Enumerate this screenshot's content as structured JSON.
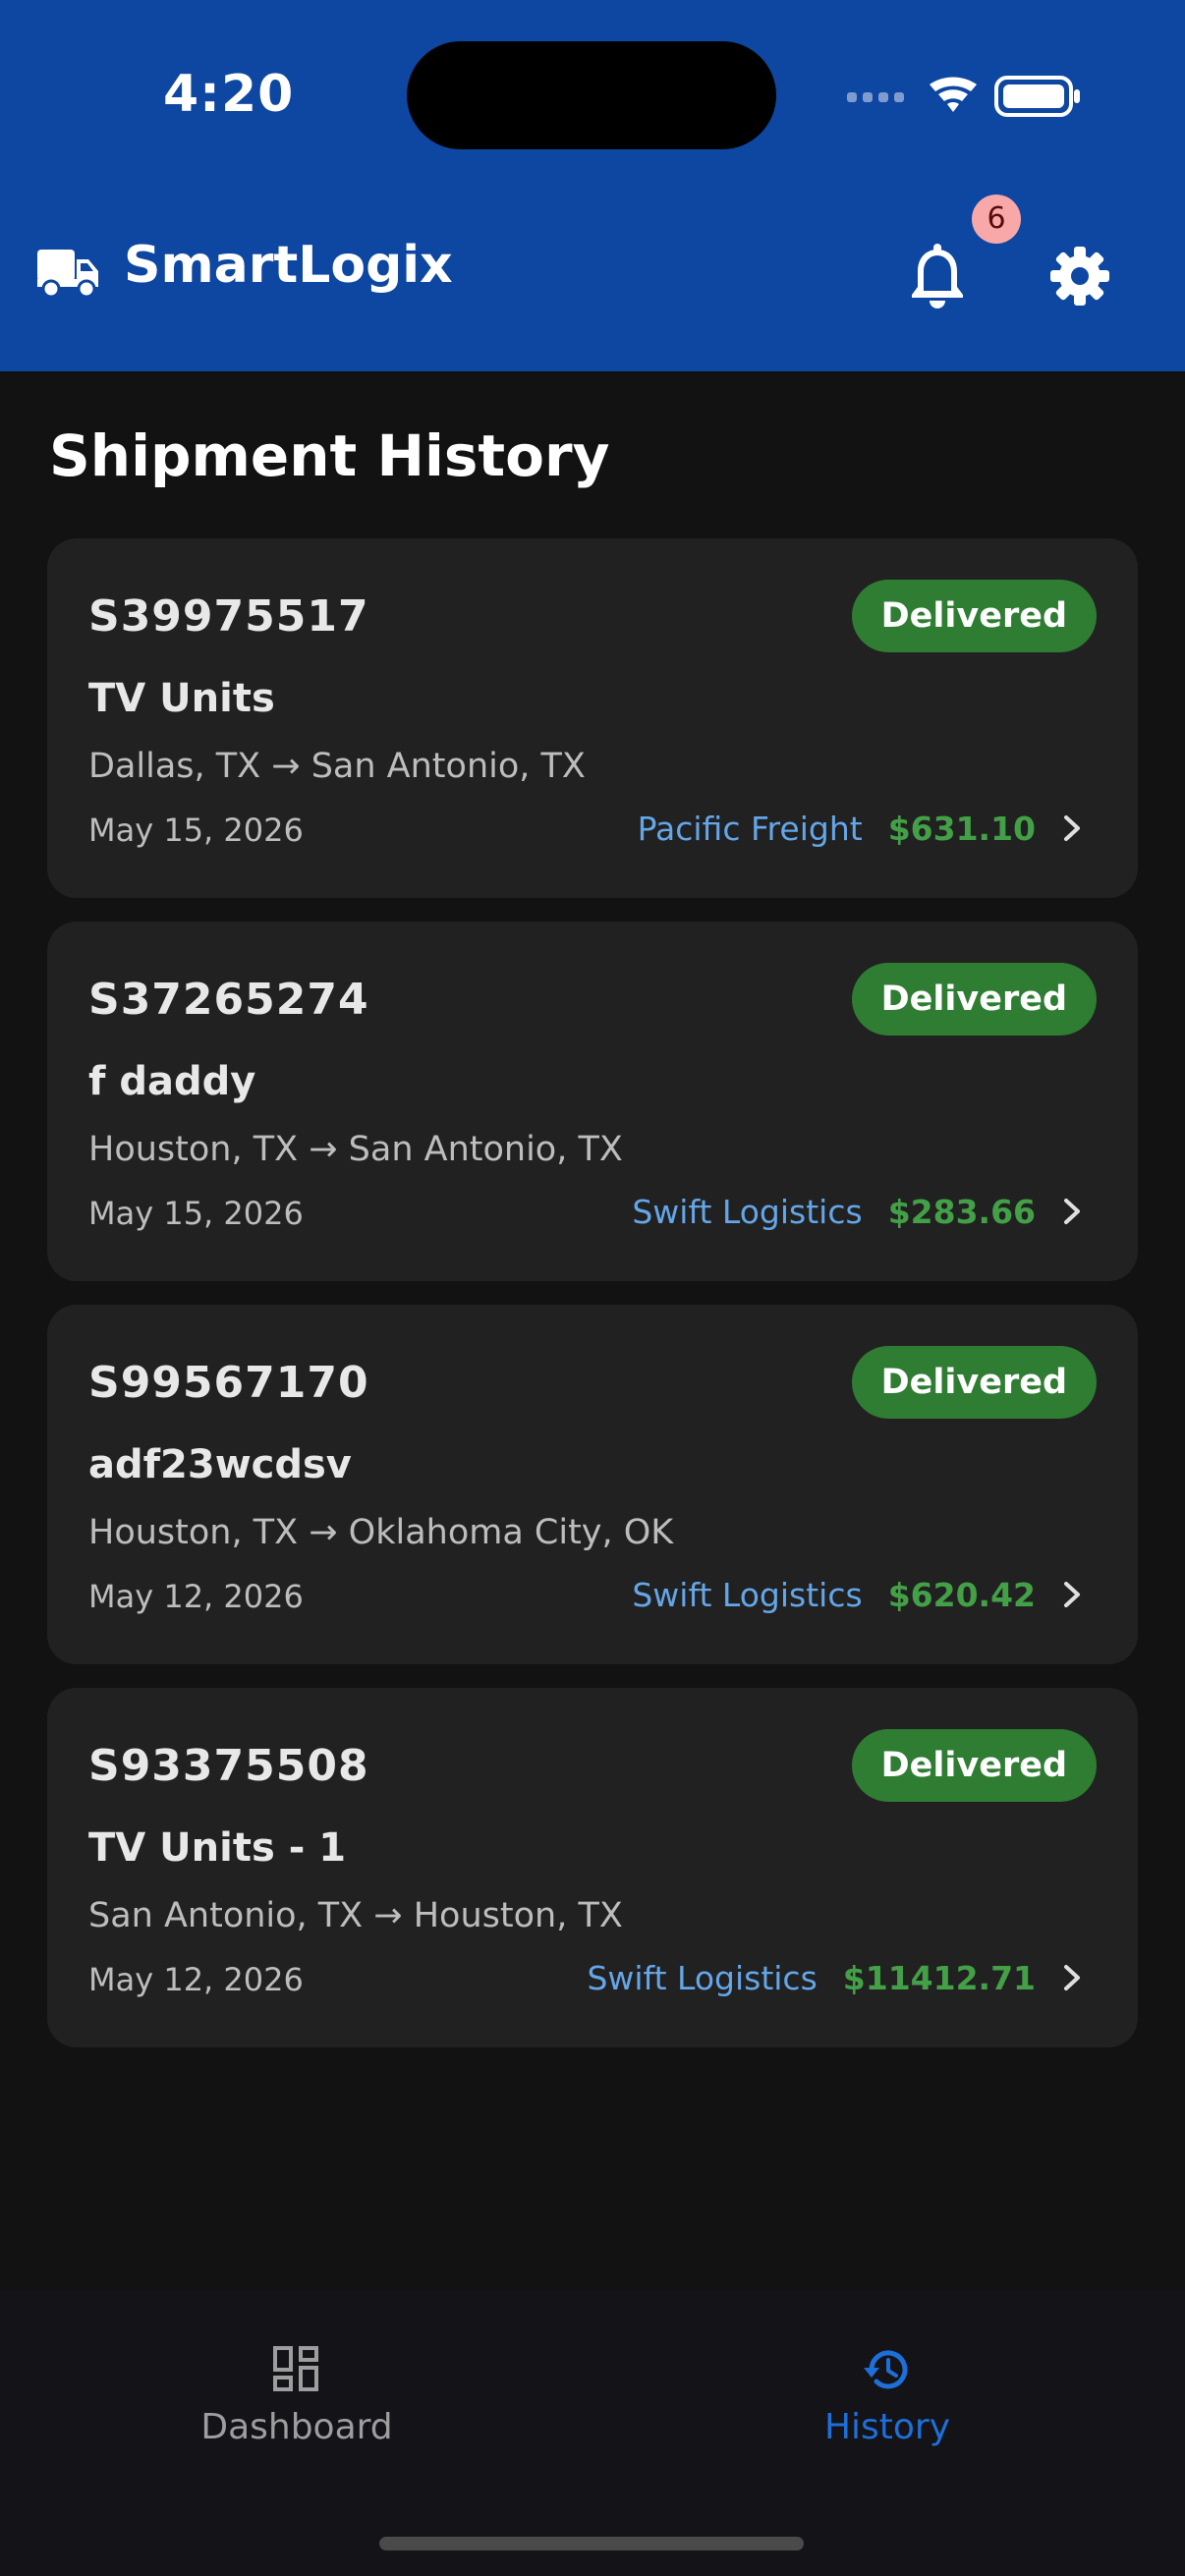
{
  "status_bar": {
    "time": "4:20"
  },
  "app_bar": {
    "title": "SmartLogix",
    "notification_count": "6",
    "logo_icon": "truck-icon",
    "bell_icon": "bell-icon",
    "settings_icon": "gear-icon"
  },
  "page": {
    "title": "Shipment History"
  },
  "shipments": [
    {
      "id": "S39975517",
      "status": "Delivered",
      "item": "TV Units",
      "route": "Dallas, TX → San Antonio, TX",
      "date": "May 15, 2026",
      "carrier": "Pacific Freight",
      "price": "$631.10"
    },
    {
      "id": "S37265274",
      "status": "Delivered",
      "item": "f daddy",
      "route": "Houston, TX → San Antonio, TX",
      "date": "May 15, 2026",
      "carrier": "Swift Logistics",
      "price": "$283.66"
    },
    {
      "id": "S99567170",
      "status": "Delivered",
      "item": "adf23wcdsv",
      "route": "Houston, TX → Oklahoma City, OK",
      "date": "May 12, 2026",
      "carrier": "Swift Logistics",
      "price": "$620.42"
    },
    {
      "id": "S93375508",
      "status": "Delivered",
      "item": "TV Units - 1",
      "route": "San Antonio, TX → Houston, TX",
      "date": "May 12, 2026",
      "carrier": "Swift Logistics",
      "price": "$11412.71"
    }
  ],
  "bottom_nav": {
    "items": [
      {
        "label": "Dashboard",
        "icon": "dashboard-icon",
        "active": false
      },
      {
        "label": "History",
        "icon": "history-icon",
        "active": true
      }
    ]
  },
  "colors": {
    "primary": "#0d47a1",
    "background": "#121212",
    "card": "#212121",
    "status_delivered": "#2e7d32",
    "carrier_link": "#64a6e8",
    "price": "#43a047",
    "nav_active": "#1e6fd9",
    "nav_inactive": "#9e9e9e"
  }
}
